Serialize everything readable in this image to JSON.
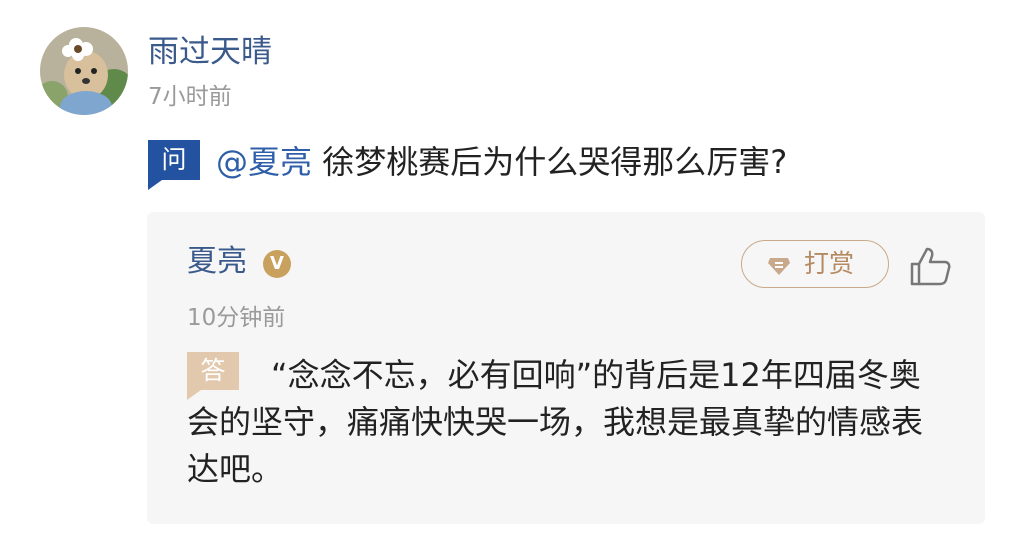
{
  "post": {
    "username": "雨过天晴",
    "time": "7小时前",
    "avatar_icon": "dog-with-flower-avatar"
  },
  "question": {
    "badge": "问",
    "mention": "@夏亮",
    "text": " 徐梦桃赛后为什么哭得那么厉害?"
  },
  "answer": {
    "name": "夏亮",
    "verified_badge": "V",
    "tip_label": "打赏",
    "tip_icon": "gem-icon",
    "like_icon": "thumbs-up-icon",
    "time": "10分钟前",
    "badge": "答",
    "text": "“念念不忘，必有回响”的背后是12年四届冬奥会的坚守，痛痛快快哭一场，我想是最真挚的情感表达吧。"
  },
  "colors": {
    "name_blue": "#3b5a8c",
    "question_badge": "#2352a0",
    "answer_badge": "#e2c9ad",
    "gold": "#c9a15f"
  }
}
